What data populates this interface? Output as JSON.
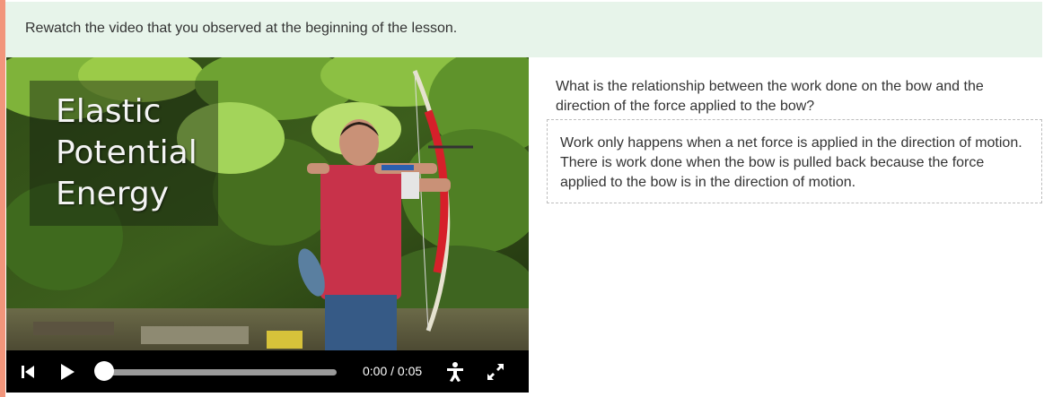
{
  "banner": {
    "instruction": "Rewatch the video that you observed at the beginning of the lesson."
  },
  "video": {
    "overlay_title": "Elastic Potential Energy",
    "controls": {
      "time_display": "0:00 / 0:05",
      "progress": 0,
      "icons": [
        "skip-back-icon",
        "play-icon",
        "accessibility-icon",
        "fullscreen-icon"
      ]
    }
  },
  "question": {
    "prompt": "What is the relationship between the work done on the bow and the direction of the force applied to the bow?",
    "answer": "Work only happens when a net force is applied in the direction of motion. There is work done when the bow is pulled back because the force applied to the bow is in the direction of motion."
  },
  "colors": {
    "accent": "#f2957b",
    "banner_bg": "#e7f4ea"
  }
}
